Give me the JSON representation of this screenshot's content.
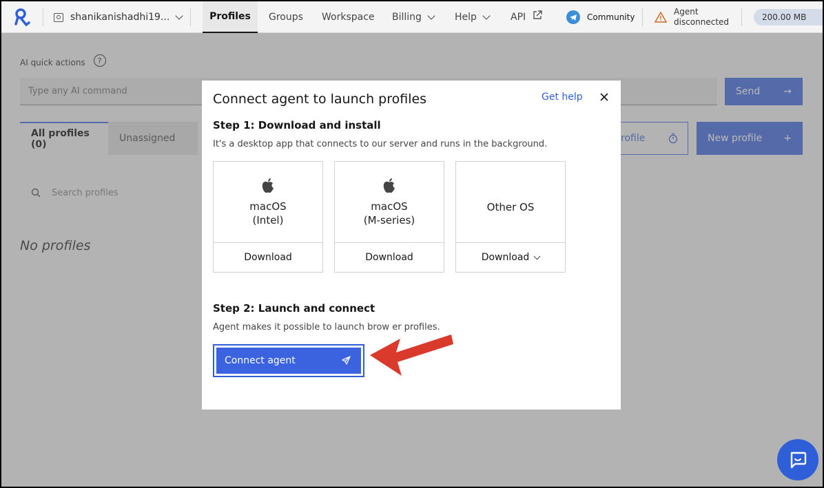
{
  "nav": {
    "workspace_name": "shanikanishadhi19...",
    "tabs": [
      {
        "label": "Profiles"
      },
      {
        "label": "Groups"
      },
      {
        "label": "Workspace"
      },
      {
        "label": "Billing"
      },
      {
        "label": "Help"
      },
      {
        "label": "API"
      }
    ],
    "community_label": "Community",
    "agent_status_line1": "Agent",
    "agent_status_line2": "disconnected",
    "storage": "200.00 MB"
  },
  "ai": {
    "label": "AI quick actions",
    "placeholder": "Type any AI command",
    "send_label": "Send"
  },
  "profile_tabs": {
    "all_label": "All profiles (0)",
    "unassigned_label": "Unassigned"
  },
  "buttons": {
    "batch_partial_label": "rofile",
    "new_profile_label": "New profile"
  },
  "search_placeholder": "Search profiles",
  "empty_state": "No profiles",
  "modal": {
    "title": "Connect agent to launch profiles",
    "get_help": "Get help",
    "step1_title": "Step 1: Download and install",
    "step1_desc": "It's a desktop app that connects to our server and runs in the background.",
    "os_options": [
      {
        "line1": "macOS",
        "line2": "(Intel)",
        "action": "Download"
      },
      {
        "line1": "macOS",
        "line2": "(M-series)",
        "action": "Download"
      },
      {
        "line1": "Other OS",
        "line2": "",
        "action": "Download"
      }
    ],
    "step2_title": "Step 2: Launch and connect",
    "step2_desc": "Agent makes it possible to launch brow  er profiles.",
    "connect_label": "Connect agent"
  },
  "colors": {
    "primary": "#4a6fe0",
    "link": "#2f5fd8",
    "arrow": "#d93a2b",
    "warning": "#d2691e"
  }
}
